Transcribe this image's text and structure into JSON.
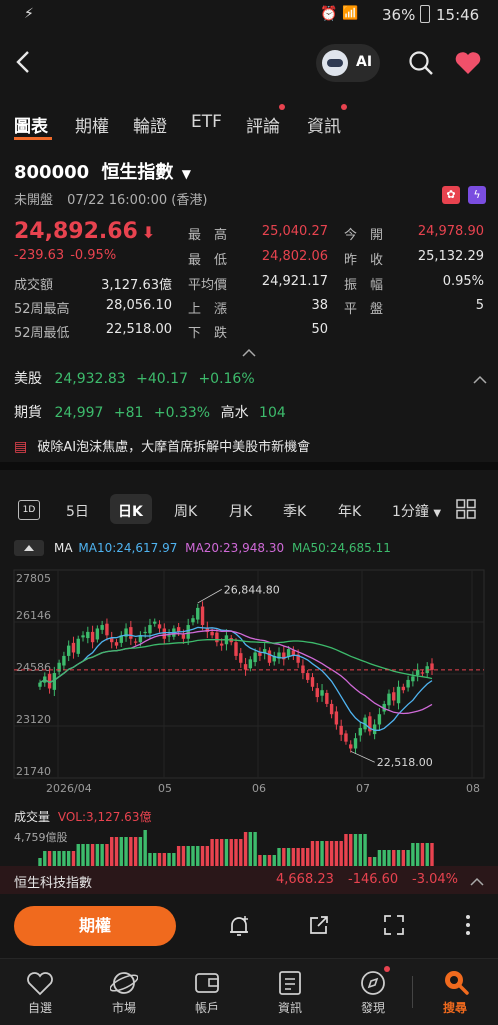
{
  "status": {
    "battery": "36%",
    "time": "15:46"
  },
  "top": {
    "ai_label": "AI"
  },
  "tabs": [
    "圖表",
    "期權",
    "輪證",
    "ETF",
    "評論",
    "資訊"
  ],
  "quote": {
    "code": "800000",
    "name": "恒生指數",
    "market_status": "未開盤",
    "timestamp": "07/22 16:00:00 (香港)",
    "price": "24,892.66",
    "change": "-239.63",
    "change_pct": "-0.95%",
    "stats": [
      {
        "label": "最　高",
        "value": "25,040.27",
        "color": "red"
      },
      {
        "label": "今　開",
        "value": "24,978.90",
        "color": "red"
      },
      {
        "label": "最　低",
        "value": "24,802.06",
        "color": "red"
      },
      {
        "label": "昨　收",
        "value": "25,132.29",
        "color": "white"
      },
      {
        "label": "平均價",
        "value": "24,921.17",
        "color": "white"
      },
      {
        "label": "振　幅",
        "value": "0.95%",
        "color": "white"
      },
      {
        "label": "上　漲",
        "value": "38",
        "color": "white"
      },
      {
        "label": "平　盤",
        "value": "5",
        "color": "white"
      },
      {
        "label": "下　跌",
        "value": "50",
        "color": "white"
      }
    ],
    "left_stats": [
      {
        "label": "成交額",
        "value": "3,127.63億"
      },
      {
        "label": "52周最高",
        "value": "28,056.10"
      },
      {
        "label": "52周最低",
        "value": "22,518.00"
      }
    ]
  },
  "us": {
    "label": "美股",
    "value": "24,932.83",
    "change": "+40.17",
    "pct": "+0.16%"
  },
  "futures": {
    "label": "期貨",
    "value": "24,997",
    "change": "+81",
    "pct": "+0.33%",
    "extra_label": "高水",
    "extra_value": "104"
  },
  "news": "破除AI泡沫焦慮，大摩首席拆解中美股市新機會",
  "periods": [
    "5日",
    "日K",
    "周K",
    "月K",
    "季K",
    "年K",
    "1分鐘"
  ],
  "ma": {
    "label": "MA",
    "ma10": "MA10:24,617.97",
    "ma20": "MA20:23,948.30",
    "ma50": "MA50:24,685.11"
  },
  "chart_data": {
    "type": "candlestick",
    "y_ticks": [
      "27805",
      "26146",
      "24586",
      "23120",
      "21740"
    ],
    "ylim": [
      21740,
      27805
    ],
    "x_ticks": [
      "2026/04",
      "05",
      "06",
      "07",
      "08"
    ],
    "annotations": {
      "high": "26,844.80",
      "low": "22,518.00"
    },
    "reference_line": 24892.66,
    "closes": [
      24520,
      24700,
      24350,
      24800,
      25100,
      25300,
      25600,
      25400,
      25800,
      25900,
      26000,
      25700,
      26100,
      26200,
      25900,
      25700,
      25600,
      25900,
      26100,
      25800,
      25700,
      25900,
      26000,
      26200,
      26300,
      26100,
      25800,
      25900,
      26100,
      26000,
      25800,
      26200,
      26400,
      26700,
      26200,
      26000,
      25900,
      25700,
      25600,
      25900,
      25700,
      25300,
      25100,
      24900,
      25200,
      25400,
      25300,
      25500,
      25100,
      25300,
      25400,
      25200,
      25500,
      25300,
      25100,
      24800,
      24600,
      24400,
      24100,
      24300,
      23900,
      23600,
      23300,
      23000,
      22800,
      22600,
      22900,
      23200,
      23500,
      23100,
      23300,
      23600,
      23900,
      24200,
      24000,
      24400,
      24300,
      24600,
      24700,
      24900,
      24800,
      25000,
      24893
    ]
  },
  "volume": {
    "label": "成交量",
    "vol": "VOL:3,127.63億",
    "max": "4,759億股"
  },
  "tech": {
    "name": "恒生科技指數",
    "value": "4,668.23",
    "change": "-146.60",
    "pct": "-3.04%"
  },
  "action": {
    "options": "期權"
  },
  "nav": [
    "自選",
    "市場",
    "帳戶",
    "資訊",
    "發現",
    "搜尋"
  ]
}
